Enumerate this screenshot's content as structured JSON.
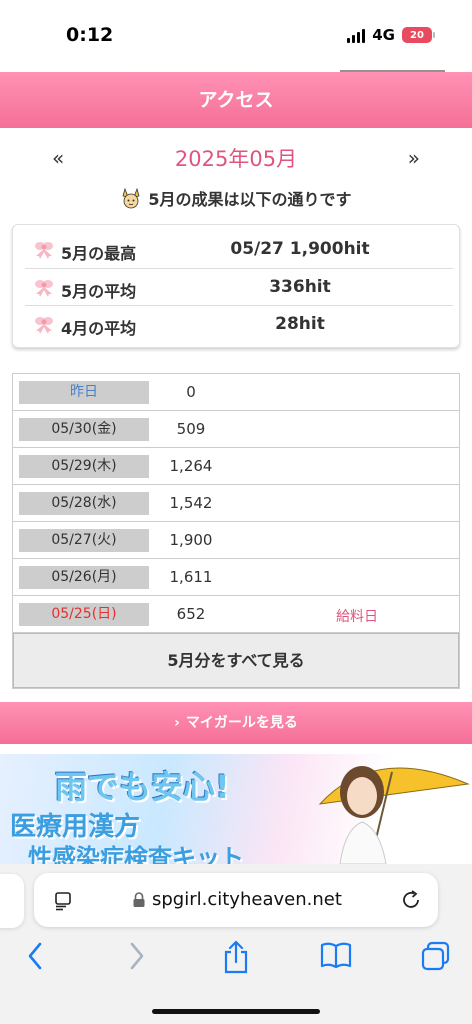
{
  "status": {
    "time": "0:12",
    "network": "4G",
    "battery": "20"
  },
  "header": {
    "title": "アクセス"
  },
  "nav": {
    "prev": "«",
    "month": "2025年05月",
    "next": "»"
  },
  "summary": {
    "text": "5月の成果は以下の通りです"
  },
  "stats": [
    {
      "label": "5月の最高",
      "value": "05/27 1,900hit"
    },
    {
      "label": "5月の平均",
      "value": "336hit"
    },
    {
      "label": "4月の平均",
      "value": "28hit"
    }
  ],
  "daily": [
    {
      "date": "昨日",
      "count": "0",
      "note": ""
    },
    {
      "date": "05/30(金)",
      "count": "509",
      "note": ""
    },
    {
      "date": "05/29(木)",
      "count": "1,264",
      "note": ""
    },
    {
      "date": "05/28(水)",
      "count": "1,542",
      "note": ""
    },
    {
      "date": "05/27(火)",
      "count": "1,900",
      "note": ""
    },
    {
      "date": "05/26(月)",
      "count": "1,611",
      "note": ""
    },
    {
      "date": "05/25(日)",
      "count": "652",
      "note": "給料日"
    }
  ],
  "view_all": "5月分をすべて見る",
  "mygirl": "マイガールを見る",
  "banner": {
    "line1": "雨でも安心!",
    "line2": "医療用漢方",
    "line3": "性感染症検査キット"
  },
  "browser": {
    "url": "spgirl.cityheaven.net"
  },
  "colors": {
    "accent_pink": "#f56f98",
    "month_title": "#e0557e",
    "today_blue": "#4a82c8",
    "sunday_red": "#e43030"
  }
}
